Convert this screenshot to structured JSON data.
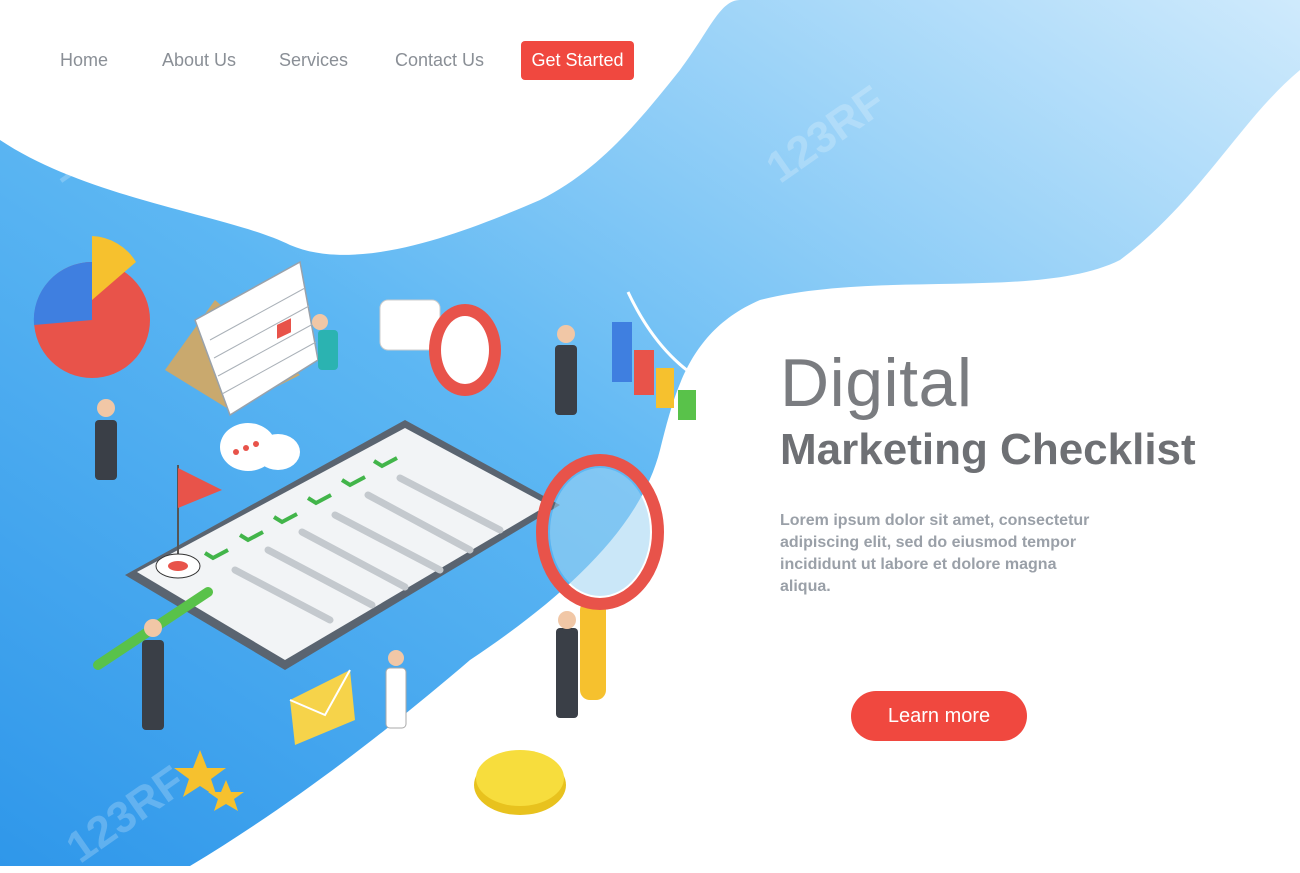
{
  "nav": {
    "items": [
      {
        "label": "Home"
      },
      {
        "label": "About Us"
      },
      {
        "label": "Services"
      },
      {
        "label": "Contact Us"
      }
    ],
    "cta_label": "Get Started"
  },
  "hero": {
    "title_line1": "Digital",
    "title_line2": "Marketing Checklist",
    "body": "Lorem ipsum dolor sit amet, consectetur adipiscing elit, sed do eiusmod tempor incididunt ut labore et dolore magna aliqua.",
    "button_label": "Learn more"
  },
  "watermark": "123RF",
  "colors": {
    "accent": "#f0483f",
    "blue_light": "#a6d8f7",
    "blue_dark": "#3aa2ef",
    "title_gray": "#7a7c80"
  }
}
